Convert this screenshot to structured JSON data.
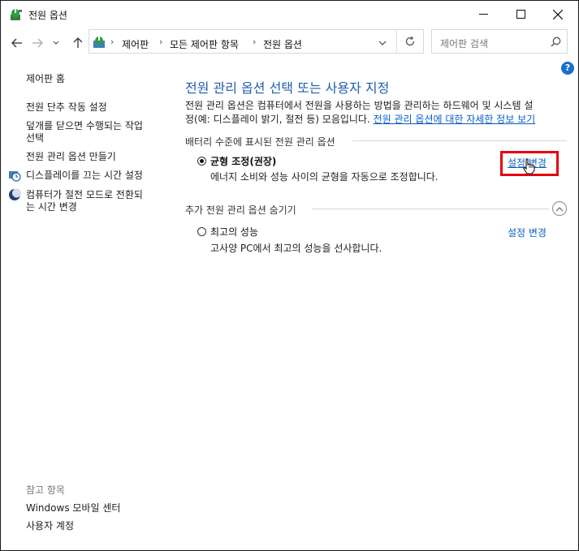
{
  "window": {
    "title": "전원 옵션"
  },
  "address": {
    "crumbs": [
      "제어판",
      "모든 제어판 항목",
      "전원 옵션"
    ],
    "search_placeholder": "제어판 검색"
  },
  "sidebar": {
    "home": "제어판 홈",
    "items": [
      "전원 단추 작동 설정",
      "덮개를 닫으면 수행되는 작업",
      "선택",
      "전원 관리 옵션 만들기",
      "디스플레이를 끄는 시간 설정",
      "컴퓨터가 절전 모드로 전환되",
      "는 시간 변경"
    ],
    "see_also_label": "참고 항목",
    "see_also": [
      "Windows 모바일 센터",
      "사용자 계정"
    ]
  },
  "main": {
    "title": "전원 관리 옵션 선택 또는 사용자 지정",
    "desc_line1": "전원 관리 옵션은 컴퓨터에서 전원을 사용하는 방법을 관리하는 하드웨어 및 시스템 설",
    "desc_line2": "정(예: 디스플레이 밝기, 절전 등) 모음입니다.",
    "desc_link": "전원 관리 옵션에 대한 자세한 정보 보기",
    "battery_section": "배터리 수준에 표시된 전원 관리 옵션",
    "extra_section": "추가 전원 관리 옵션 숨기기",
    "plans": [
      {
        "name": "균형 조정(권장)",
        "desc": "에너지 소비와 성능 사이의 균형을 자동으로 조정합니다.",
        "link": "설정 변경",
        "selected": true
      },
      {
        "name": "최고의 성능",
        "desc": "고사양 PC에서 최고의 성능을 선사합니다.",
        "link": "설정 변경",
        "selected": false
      }
    ]
  },
  "colors": {
    "title_blue": "#1e5fa8",
    "link_blue": "#0a5fc4",
    "highlight_red": "#e60012"
  }
}
